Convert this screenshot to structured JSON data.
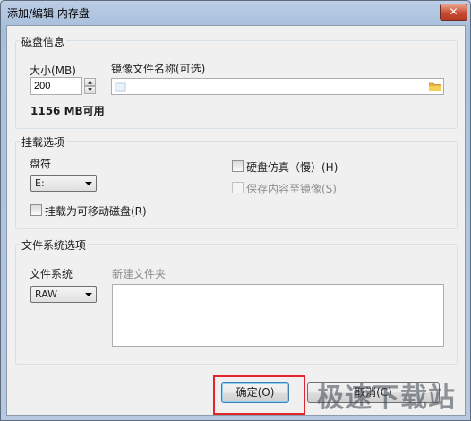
{
  "window": {
    "title": "添加/编辑 内存盘",
    "close_glyph": "✕"
  },
  "disk_info": {
    "group_label": "磁盘信息",
    "size_label": "大小(MB)",
    "size_value": "200",
    "available": "1156 MB可用",
    "image_name_label": "镜像文件名称(可选)",
    "image_name_value": ""
  },
  "mount_options": {
    "group_label": "挂载选项",
    "drive_letter_label": "盘符",
    "drive_letter_value": "E:",
    "removable_label": "挂载为可移动磁盘(R)",
    "hdd_emulation_label": "硬盘仿真（慢）(H)",
    "save_to_image_label": "保存内容至镜像(S)"
  },
  "fs_options": {
    "group_label": "文件系统选项",
    "fs_label": "文件系统",
    "fs_value": "RAW",
    "new_folder_label": "新建文件夹"
  },
  "footer": {
    "ok_label": "确定(O)",
    "cancel_label": "取消(C)"
  },
  "watermark": "极速下载站",
  "colors": {
    "highlight": "#e0262a",
    "close": "#c74b31"
  }
}
